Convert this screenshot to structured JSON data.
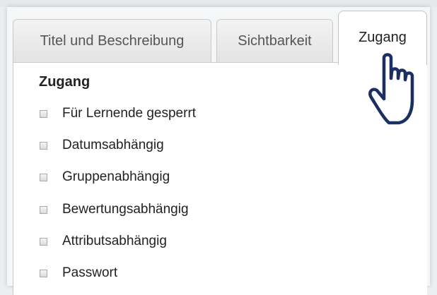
{
  "tabs": [
    {
      "label": "Titel und Beschreibung",
      "active": false
    },
    {
      "label": "Sichtbarkeit",
      "active": false
    },
    {
      "label": "Zugang",
      "active": true
    }
  ],
  "section": {
    "title": "Zugang",
    "options": [
      {
        "label": "Für Lernende gesperrt",
        "checked": false
      },
      {
        "label": "Datumsabhängig",
        "checked": false
      },
      {
        "label": "Gruppenabhängig",
        "checked": false
      },
      {
        "label": "Bewertungsabhängig",
        "checked": false
      },
      {
        "label": "Attributsabhängig",
        "checked": false
      },
      {
        "label": "Passwort",
        "checked": false
      }
    ]
  },
  "cursor": {
    "icon": "hand-pointer-icon",
    "outline_color": "#1b2f63",
    "glow_color": "#ffffff"
  }
}
